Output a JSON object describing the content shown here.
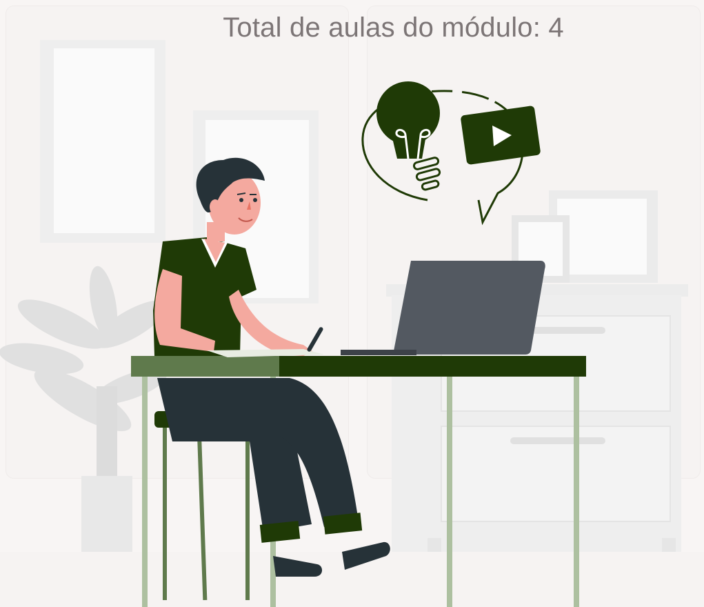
{
  "header": {
    "title": "Total de aulas do módulo: 4"
  },
  "colors": {
    "background": "#f8f5f4",
    "title_text": "#7c7576",
    "accent_dark_green": "#1f3a06",
    "table_light_green": "#5f7a4c",
    "laptop_gray": "#535961",
    "skin": "#f4a99f",
    "hair": "#263238"
  },
  "icons": {
    "lightbulb": "lightbulb-icon",
    "play": "play-video-icon"
  }
}
